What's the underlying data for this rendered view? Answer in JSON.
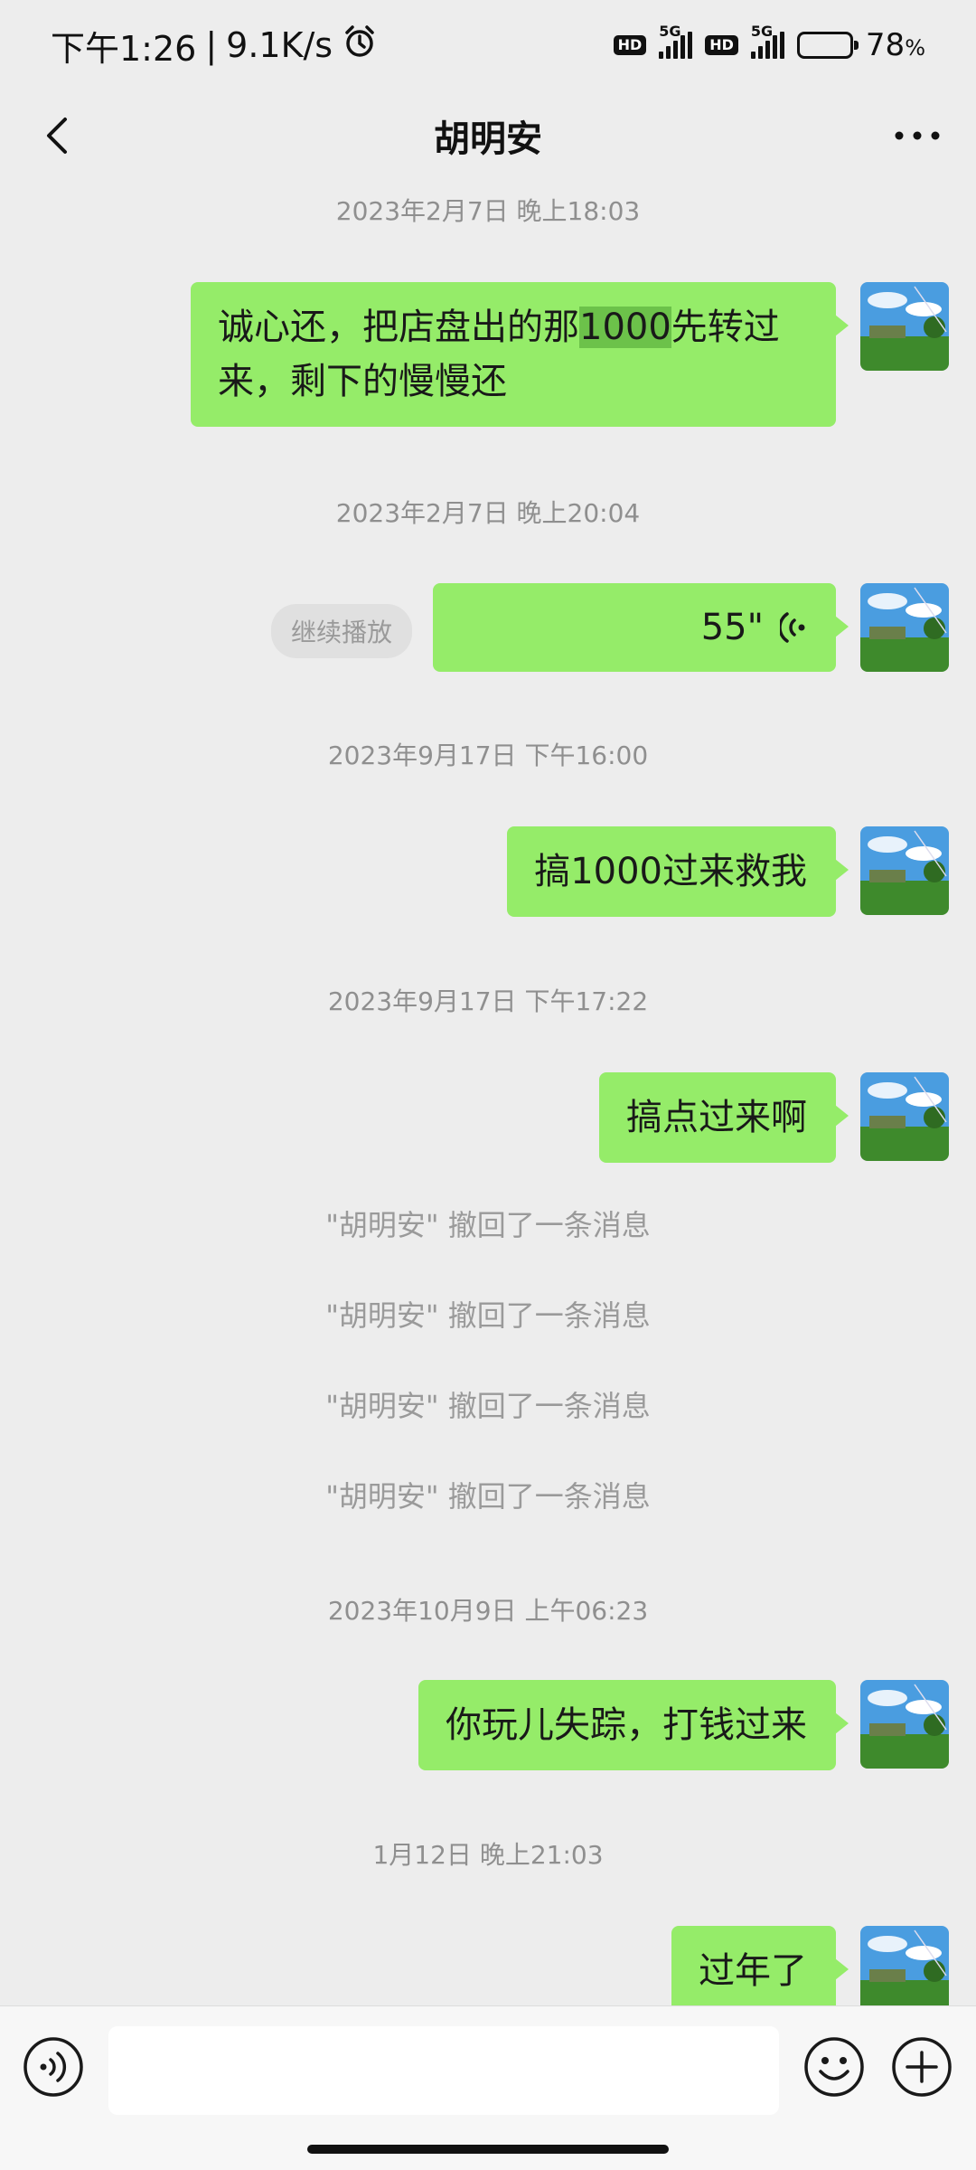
{
  "status_bar": {
    "time": "下午1:26",
    "speed": "9.1K/s",
    "hd": "HD",
    "network": "5G",
    "battery_percent": "78",
    "battery_unit": "%"
  },
  "header": {
    "title": "胡明安"
  },
  "messages": [
    {
      "type": "timestamp",
      "text": "2023年2月7日 晚上18:03"
    },
    {
      "type": "text",
      "before": "诚心还，把店盘出的那",
      "highlight": "1000",
      "after": "先转过来，剩下的慢慢还"
    },
    {
      "type": "timestamp",
      "text": "2023年2月7日 晚上20:04"
    },
    {
      "type": "voice",
      "duration": "55\"",
      "continue_label": "继续播放"
    },
    {
      "type": "timestamp",
      "text": "2023年9月17日 下午16:00"
    },
    {
      "type": "text",
      "text": "搞1000过来救我"
    },
    {
      "type": "timestamp",
      "text": "2023年9月17日 下午17:22"
    },
    {
      "type": "text",
      "text": "搞点过来啊"
    },
    {
      "type": "recall",
      "text": "\"胡明安\" 撤回了一条消息"
    },
    {
      "type": "recall",
      "text": "\"胡明安\" 撤回了一条消息"
    },
    {
      "type": "recall",
      "text": "\"胡明安\" 撤回了一条消息"
    },
    {
      "type": "recall",
      "text": "\"胡明安\" 撤回了一条消息"
    },
    {
      "type": "timestamp",
      "text": "2023年10月9日 上午06:23"
    },
    {
      "type": "text",
      "text": "你玩儿失踪，打钱过来"
    },
    {
      "type": "timestamp",
      "text": "1月12日 晚上21:03"
    },
    {
      "type": "text",
      "text": "过年了"
    }
  ],
  "input": {
    "value": ""
  },
  "colors": {
    "bubble": "#95ec69",
    "background": "#ededed",
    "highlight": "#6cc24a"
  }
}
